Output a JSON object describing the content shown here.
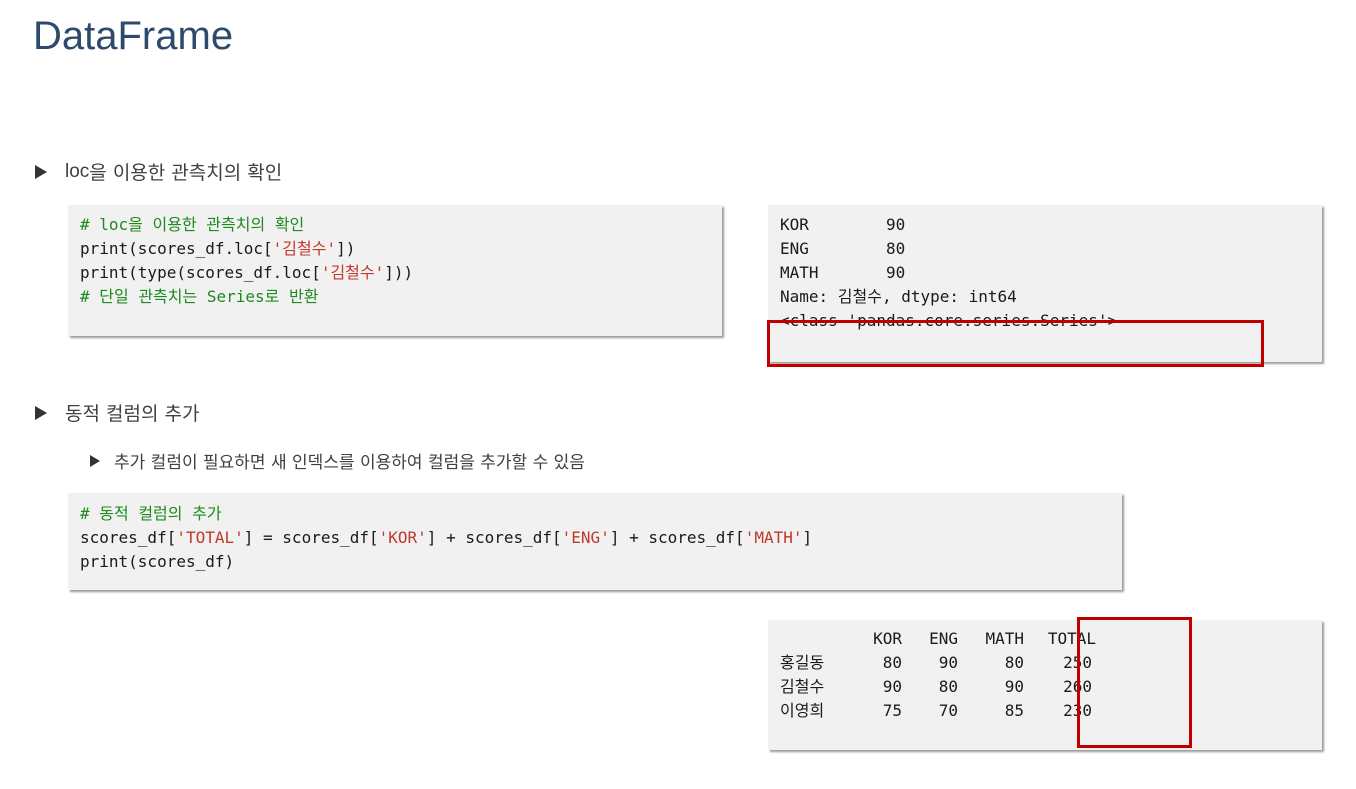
{
  "slide": {
    "title": "DataFrame"
  },
  "section1": {
    "bullet_prefix": "loc",
    "bullet_rest": "을 이용한 관측치의 확인",
    "code": {
      "line1": "# loc을 이용한 관측치의 확인",
      "line2_pre": "print(scores_df.loc[",
      "line2_str": "'김철수'",
      "line2_post": "])",
      "line3_pre": "print(type(scores_df.loc[",
      "line3_str": "'김철수'",
      "line3_post": "]))",
      "line4": "# 단일 관측치는 Series로 반환"
    },
    "output": {
      "row1_label": "KOR",
      "row1_value": "90",
      "row2_label": "ENG",
      "row2_value": "80",
      "row3_label": "MATH",
      "row3_value": "90",
      "row4": "Name: 김철수, dtype: int64",
      "row5": "<class 'pandas.core.series.Series'>"
    }
  },
  "section2": {
    "bullet": "동적 컬럼의 추가",
    "sub_bullet": "추가 컬럼이 필요하면 새 인덱스를 이용하여 컬럼을 추가할 수 있음",
    "code": {
      "line1": "# 동적 컬럼의 추가",
      "l2_a": "scores_df[",
      "l2_s1": "'TOTAL'",
      "l2_b": "] = scores_df[",
      "l2_s2": "'KOR'",
      "l2_c": "] + scores_df[",
      "l2_s3": "'ENG'",
      "l2_d": "] + scores_df[",
      "l2_s4": "'MATH'",
      "l2_e": "]",
      "line3": "print(scores_df)"
    },
    "table": {
      "headers": [
        "KOR",
        "ENG",
        "MATH",
        "TOTAL"
      ],
      "rows": [
        {
          "name": "홍길동",
          "values": [
            "80",
            "90",
            "80",
            "250"
          ]
        },
        {
          "name": "김철수",
          "values": [
            "90",
            "80",
            "90",
            "260"
          ]
        },
        {
          "name": "이영희",
          "values": [
            "75",
            "70",
            "85",
            "230"
          ]
        }
      ]
    }
  },
  "colors": {
    "title": "#2e4a6b",
    "comment": "#1e8a1e",
    "string": "#c0392b",
    "highlight": "#c00000",
    "code_bg": "#f1f1f1"
  }
}
